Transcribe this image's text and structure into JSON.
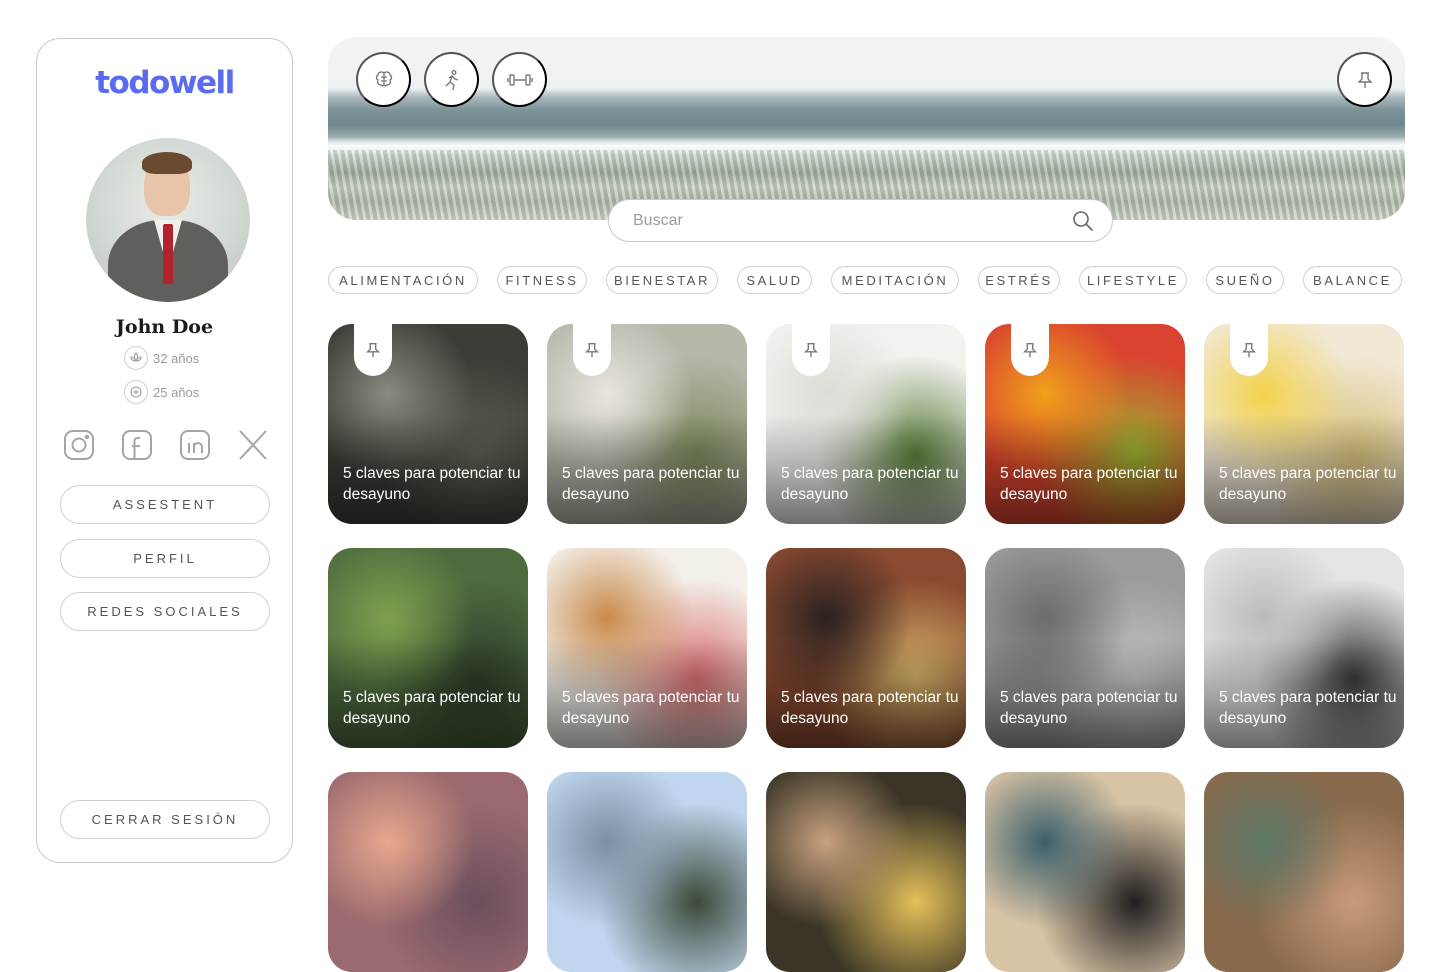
{
  "brand": {
    "logo_text": "todowell",
    "accent": "#5a6bf0"
  },
  "profile": {
    "name": "John Doe",
    "stats": [
      {
        "icon": "lotus-icon",
        "value": "32 años"
      },
      {
        "icon": "brain-circle-icon",
        "value": "25 años"
      }
    ],
    "socials": [
      "instagram-icon",
      "facebook-icon",
      "linkedin-icon",
      "x-icon"
    ]
  },
  "sidebar": {
    "buttons": [
      "ASSESTENT",
      "PERFIL",
      "REDES SOCIALES"
    ],
    "logout": "CERRAR SESIÓN"
  },
  "hero": {
    "icons": [
      "brain-icon",
      "running-icon",
      "dumbbell-icon"
    ],
    "pin_icon": "pin-icon"
  },
  "search": {
    "placeholder": "Buscar"
  },
  "categories": [
    "ALIMENTACIÓN",
    "FITNESS",
    "BIENESTAR",
    "SALUD",
    "MEDITACIÓN",
    "ESTRÉS",
    "LIFESTYLE",
    "SUEÑO",
    "BALANCE"
  ],
  "cards": [
    {
      "title": "5 claves para potenciar tu desayuno",
      "pinned": true,
      "colors": [
        "#3b3c36",
        "#8c8a80",
        "#5e5f52"
      ]
    },
    {
      "title": "5 claves para potenciar tu desayuno",
      "pinned": true,
      "colors": [
        "#b7b7aa",
        "#e8e4de",
        "#7a8a5c"
      ]
    },
    {
      "title": "5 claves para potenciar tu desayuno",
      "pinned": true,
      "colors": [
        "#f2f2ef",
        "#dcdcd6",
        "#5c7f3d"
      ]
    },
    {
      "title": "5 claves para potenciar tu desayuno",
      "pinned": true,
      "colors": [
        "#d9432f",
        "#f0a11c",
        "#9bb430"
      ]
    },
    {
      "title": "5 claves para potenciar tu desayuno",
      "pinned": true,
      "colors": [
        "#f1e8d6",
        "#f3d24a",
        "#d8c07a"
      ]
    },
    {
      "title": "5 claves para potenciar tu desayuno",
      "pinned": false,
      "colors": [
        "#4e6b3f",
        "#7ea04e",
        "#2f3d2a"
      ]
    },
    {
      "title": "5 claves para potenciar tu desayuno",
      "pinned": false,
      "colors": [
        "#f3efe9",
        "#c98a4b",
        "#d96f6f"
      ]
    },
    {
      "title": "5 claves para potenciar tu desayuno",
      "pinned": false,
      "colors": [
        "#8a4a30",
        "#2a2220",
        "#d6b46a"
      ]
    },
    {
      "title": "5 claves para potenciar tu desayuno",
      "pinned": false,
      "colors": [
        "#9b9b9b",
        "#6c6c6c",
        "#c5c5c5"
      ]
    },
    {
      "title": "5 claves para potenciar tu desayuno",
      "pinned": false,
      "colors": [
        "#e5e6e4",
        "#b9bcbb",
        "#3a3a3a"
      ]
    },
    {
      "title": "",
      "pinned": false,
      "colors": [
        "#9b6a6e",
        "#e8a78e",
        "#6a4f5e"
      ]
    },
    {
      "title": "",
      "pinned": false,
      "colors": [
        "#bfd6ee",
        "#7c8fa3",
        "#3c4a3a"
      ]
    },
    {
      "title": "",
      "pinned": false,
      "colors": [
        "#3a3526",
        "#c9a27f",
        "#e5c05a"
      ]
    },
    {
      "title": "",
      "pinned": false,
      "colors": [
        "#d9c4a5",
        "#3b5f6b",
        "#1f1f1f"
      ]
    },
    {
      "title": "",
      "pinned": false,
      "colors": [
        "#8a6a4c",
        "#5d7866",
        "#c99a7c"
      ]
    }
  ]
}
